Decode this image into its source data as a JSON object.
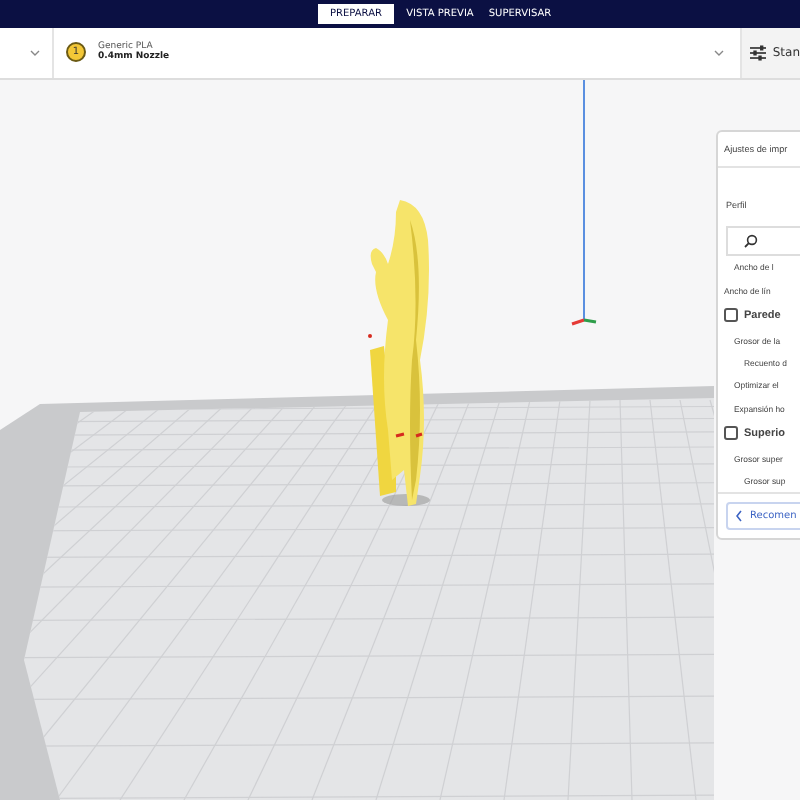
{
  "stage_tabs": [
    {
      "label": "PREPARAR",
      "selected": true
    },
    {
      "label": "VISTA PREVIA",
      "selected": false
    },
    {
      "label": "SUPERVISAR",
      "selected": false
    }
  ],
  "material": {
    "badge": "1",
    "name": "Generic PLA",
    "nozzle": "0.4mm Nozzle"
  },
  "settings_button": {
    "label": "Stan"
  },
  "print_settings": {
    "title": "Ajustes de impr",
    "profile_label": "Perfil",
    "items": [
      {
        "kind": "sub",
        "label": "Ancho de l"
      },
      {
        "kind": "setting",
        "label": "Ancho de lín"
      },
      {
        "kind": "category",
        "label": "Parede",
        "children": [
          {
            "kind": "setting",
            "label": "Grosor de la",
            "children": [
              {
                "kind": "setting",
                "label": "Recuento d"
              }
            ]
          },
          {
            "kind": "setting",
            "label": "Optimizar el"
          },
          {
            "kind": "setting",
            "label": "Expansión ho"
          }
        ]
      },
      {
        "kind": "category",
        "label": "Superio",
        "children": [
          {
            "kind": "setting",
            "label": "Grosor super",
            "children": [
              {
                "kind": "setting",
                "label": "Grosor sup"
              }
            ]
          }
        ]
      }
    ],
    "back_button": "Recomen"
  }
}
